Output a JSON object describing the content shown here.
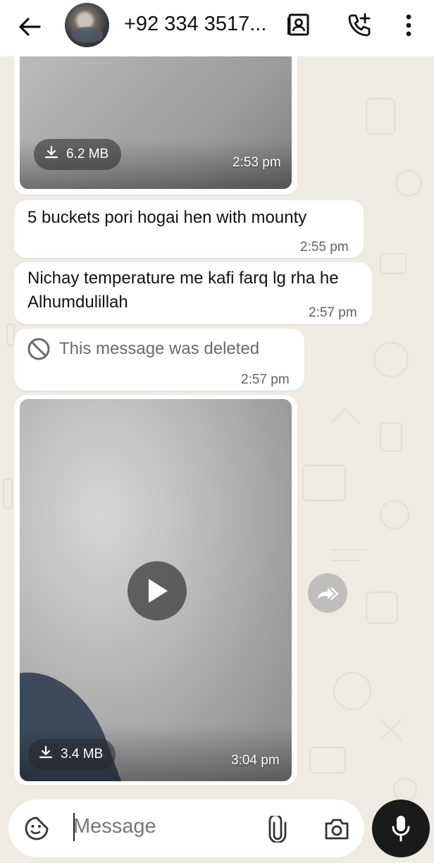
{
  "header": {
    "contact_name": "+92 334 3517...",
    "icons": [
      "back-arrow-icon",
      "avatar",
      "contact-card-icon",
      "add-call-icon",
      "more-vert-icon"
    ]
  },
  "messages": [
    {
      "type": "video",
      "size": "6.2 MB",
      "time": "2:53 pm"
    },
    {
      "type": "text",
      "text": "5 buckets pori hogai hen with mounty",
      "time": "2:55 pm"
    },
    {
      "type": "text",
      "text": "Nichay temperature me kafi farq lg rha he Alhumdulillah",
      "time": "2:57 pm"
    },
    {
      "type": "deleted",
      "text": "This message was deleted",
      "time": "2:57 pm"
    },
    {
      "type": "video",
      "size": "3.4 MB",
      "time": "3:04 pm"
    }
  ],
  "input": {
    "placeholder": "Message"
  },
  "colors": {
    "chat_bg": "#efeae2",
    "bubble": "#ffffff",
    "mic_button": "#1a1a1a"
  }
}
